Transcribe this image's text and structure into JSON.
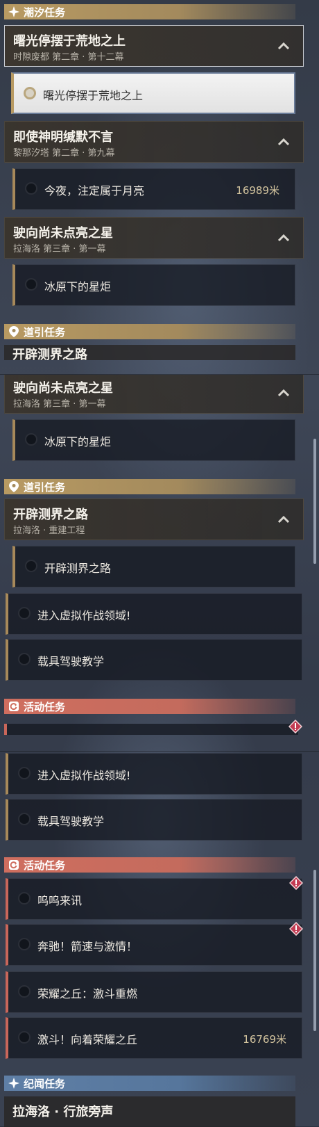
{
  "sections": {
    "tide": "潮汐任务",
    "guide": "道引任务",
    "event": "活动任务",
    "chronicle": "纪闻任务"
  },
  "chapters": {
    "c1": {
      "title": "曙光停摆于荒地之上",
      "subtitle": "时隙废都 第二章 · 第十二幕"
    },
    "c2": {
      "title": "即使神明缄默不言",
      "subtitle": "黎那汐塔 第二章 · 第九幕"
    },
    "c3": {
      "title": "驶向尚未点亮之星",
      "subtitle": "拉海洛 第三章 · 第一幕"
    },
    "g1": {
      "title": "开辟测界之路",
      "subtitle": "拉海洛 · 重建工程"
    },
    "r1": {
      "title": "拉海洛 · 行旅旁声"
    }
  },
  "tasks": {
    "t1": {
      "label": "曙光停摆于荒地之上"
    },
    "t2": {
      "label": "今夜，注定属于月亮",
      "distance": "16989米"
    },
    "t3": {
      "label": "冰原下的星炬"
    },
    "g1": {
      "label": "开辟测界之路"
    },
    "g2": {
      "label": "进入虚拟作战领域!"
    },
    "g3": {
      "label": "载具驾驶教学"
    },
    "e1": {
      "label": "呜呜来讯"
    },
    "e2": {
      "label": "奔驰！箭速与激情！"
    },
    "e3": {
      "label": "荣耀之丘：激斗重燃"
    },
    "e4": {
      "label": "激斗！向着荣耀之丘",
      "distance": "16769米"
    }
  },
  "colors": {
    "gold": "#b89a62",
    "red": "#cf6e5f",
    "blue": "#5f7fa6"
  }
}
